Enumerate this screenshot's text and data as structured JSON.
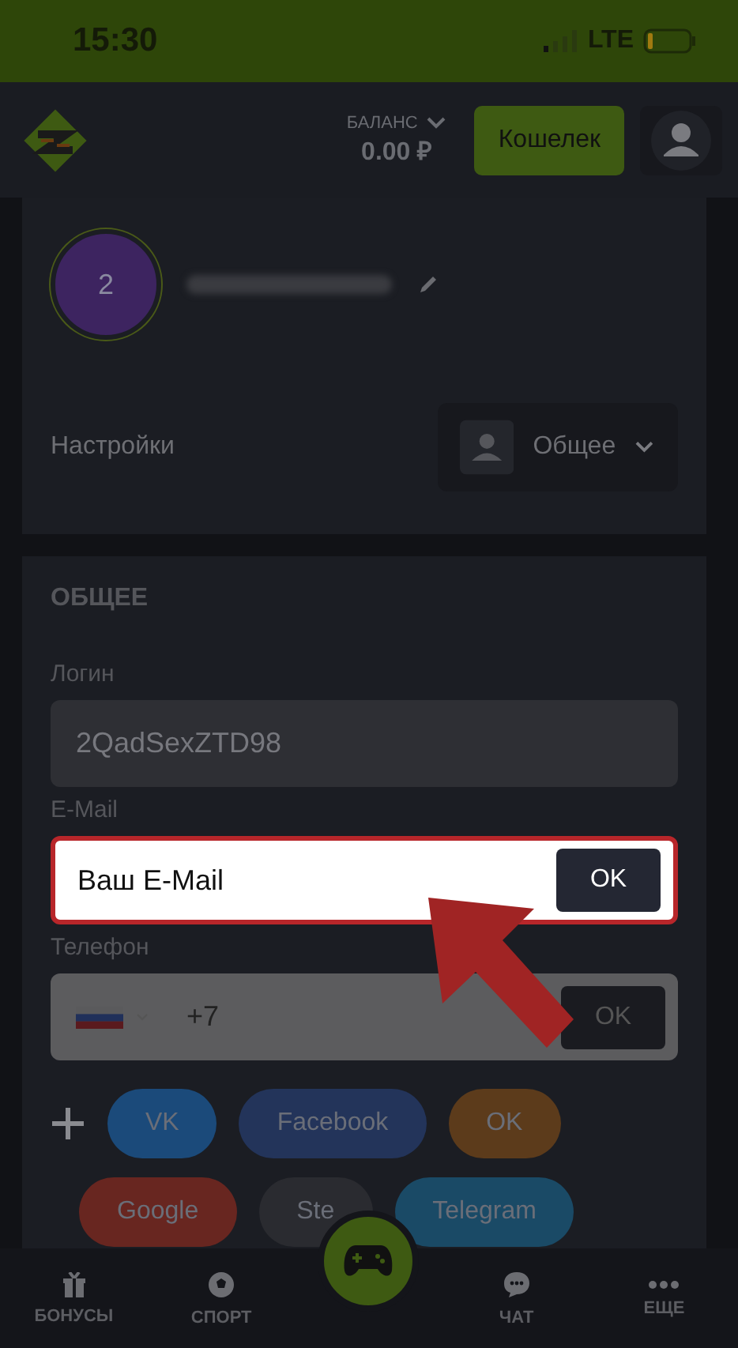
{
  "status_bar": {
    "time": "15:30",
    "network": "LTE"
  },
  "header": {
    "balance_label": "БАЛАНС",
    "balance": "0.00 ₽",
    "wallet_button": "Кошелек"
  },
  "profile": {
    "level": "2"
  },
  "settings": {
    "label": "Настройки",
    "dropdown": "Общее"
  },
  "section": {
    "title": "ОБЩЕЕ",
    "fields": [
      {
        "kind": "text",
        "label": "Логин",
        "value": "2QadSexZTD98",
        "highlighted": false
      },
      {
        "kind": "email",
        "label": "E-Mail",
        "placeholder": "Ваш E-Mail",
        "button": "OK",
        "highlighted": true
      },
      {
        "kind": "phone",
        "label": "Телефон",
        "value": "+7",
        "button": "OK",
        "highlighted": false
      }
    ]
  },
  "socials": [
    {
      "label": "VK",
      "color": "#1b4a7a"
    },
    {
      "label": "Facebook",
      "color": "#23345a"
    },
    {
      "label": "OK",
      "color": "#5c3b1b"
    },
    {
      "label": "Google",
      "color": "#682620"
    },
    {
      "label": "Ste",
      "color": "#2a2b30"
    },
    {
      "label": "Telegram",
      "color": "#1a4a66"
    }
  ],
  "nav": [
    {
      "kind": "tab",
      "label": "БОНУСЫ"
    },
    {
      "kind": "tab",
      "label": "СПОРТ"
    },
    {
      "kind": "play"
    },
    {
      "kind": "tab",
      "label": "ЧАТ"
    },
    {
      "kind": "tab",
      "label": "ЕЩЕ"
    }
  ]
}
